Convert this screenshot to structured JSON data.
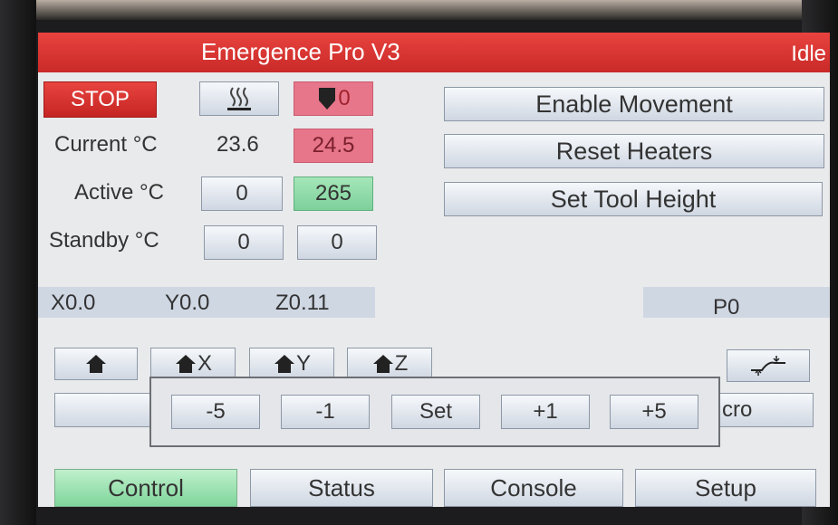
{
  "app": {
    "title": "Emergence Pro V3",
    "status": "Idle"
  },
  "controls": {
    "stop_label": "STOP",
    "bed_heater_icon": "heater-waves-icon",
    "tool_icon": "tool-head-icon",
    "tool_number": "0"
  },
  "temperatures": {
    "current_label": "Current °C",
    "active_label": "Active °C",
    "standby_label": "Standby °C",
    "bed": {
      "current": "23.6",
      "active": "0",
      "standby": "0"
    },
    "tool0": {
      "current": "24.5",
      "active": "265",
      "standby": "0"
    }
  },
  "actions": {
    "enable_movement": "Enable Movement",
    "reset_heaters": "Reset Heaters",
    "set_tool_height": "Set Tool Height"
  },
  "position": {
    "x": "X0.0",
    "y": "Y0.0",
    "z": "Z0.11",
    "p": "P0"
  },
  "home": {
    "all_icon": "home-icon",
    "x": "X",
    "y": "Y",
    "z": "Z"
  },
  "baby_step_icon": "babystep-icon",
  "macro_label_visible": "cro",
  "popup": {
    "minus5": "-5",
    "minus1": "-1",
    "set": "Set",
    "plus1": "+1",
    "plus5": "+5"
  },
  "tabs": [
    "Control",
    "Status",
    "Console",
    "Setup"
  ],
  "colors": {
    "title_bar": "#d7302c",
    "stop": "#d7302c",
    "heating": "#e7768a",
    "active_green": "#8bdca6"
  }
}
